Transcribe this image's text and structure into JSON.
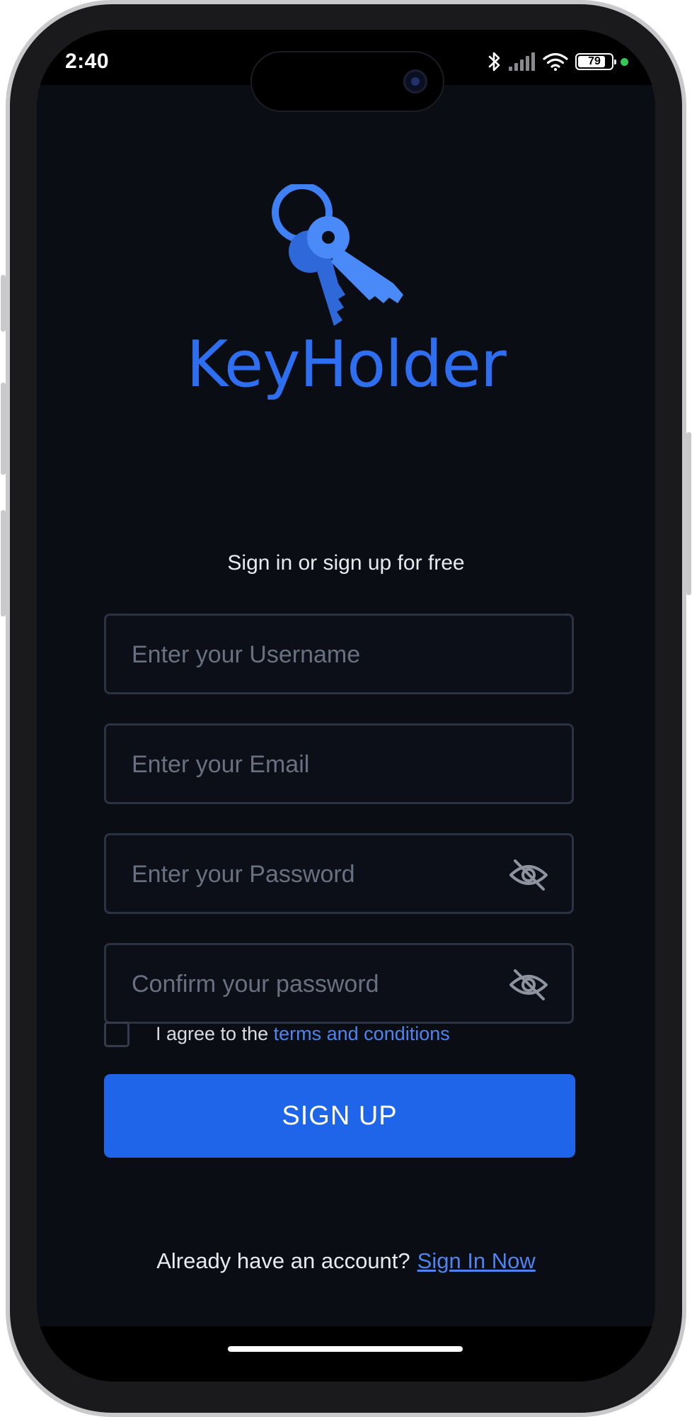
{
  "status_bar": {
    "time": "2:40",
    "battery_level": "79",
    "icons": [
      "bluetooth-icon",
      "signal-icon",
      "wifi-icon",
      "battery-icon"
    ]
  },
  "brand": {
    "name": "KeyHolder",
    "logo_icon": "keys-icon",
    "color": "#2e6ff1"
  },
  "subtitle": "Sign in or sign up for free",
  "form": {
    "username": {
      "placeholder": "Enter your Username",
      "value": ""
    },
    "email": {
      "placeholder": "Enter your Email",
      "value": ""
    },
    "password": {
      "placeholder": "Enter your Password",
      "value": "",
      "toggle_icon": "eye-off-icon"
    },
    "confirm_password": {
      "placeholder": "Confirm your password",
      "value": "",
      "toggle_icon": "eye-off-icon"
    },
    "terms": {
      "checked": false,
      "prefix": "I agree to the ",
      "link_text": "terms and conditions"
    },
    "submit_label": "SIGN UP"
  },
  "footer": {
    "prompt": "Already have an account?",
    "link_text": "Sign In Now"
  },
  "colors": {
    "background": "#0b0d14",
    "accent": "#1f65ea",
    "link": "#4e84f0",
    "field_border": "#2b3242"
  }
}
